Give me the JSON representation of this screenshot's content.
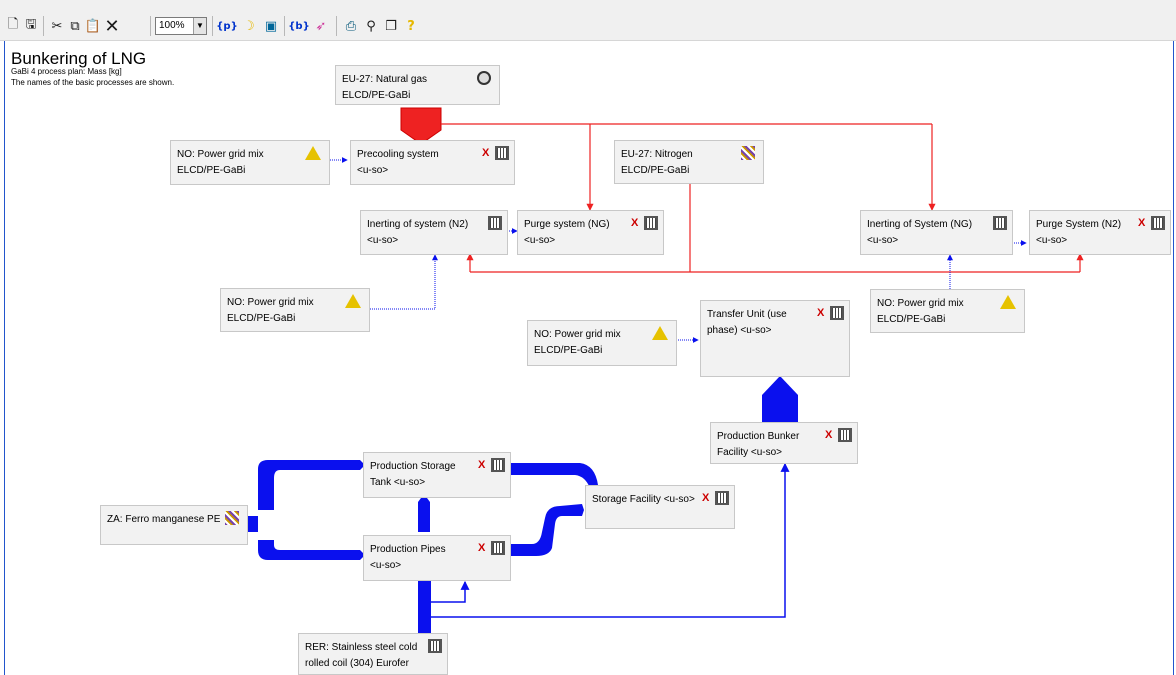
{
  "toolbar": {
    "zoom_value": "100%",
    "buttons": [
      "new-file-icon",
      "save-icon",
      "cut-icon",
      "copy-icon",
      "paste-icon",
      "delete-icon",
      "parameters-icon",
      "moon-icon",
      "layout-icon",
      "balance-icon",
      "flow-icon",
      "print-preview-icon",
      "search-icon",
      "windows-icon",
      "help-icon"
    ]
  },
  "header": {
    "title": "Bunkering of LNG",
    "line1": "GaBi 4 process plan: Mass [kg]",
    "line2": "The names of the basic processes are shown."
  },
  "processes": {
    "natural_gas": {
      "l1": "EU-27: Natural gas",
      "l2": "ELCD/PE-GaBi"
    },
    "power1": {
      "l1": "NO: Power grid mix",
      "l2": "ELCD/PE-GaBi"
    },
    "precooling": {
      "l1": "Precooling system",
      "l2": "<u-so>"
    },
    "nitrogen": {
      "l1": "EU-27: Nitrogen",
      "l2": "ELCD/PE-GaBi"
    },
    "inerting_n2": {
      "l1": "Inerting of system (N2)",
      "l2": "<u-so>"
    },
    "purge_ng": {
      "l1": "Purge system (NG)",
      "l2": "<u-so>"
    },
    "inerting_ng": {
      "l1": "Inerting of System (NG)",
      "l2": "<u-so>"
    },
    "purge_n2": {
      "l1": "Purge System (N2)",
      "l2": "<u-so>"
    },
    "power2": {
      "l1": "NO: Power grid mix",
      "l2": "ELCD/PE-GaBi"
    },
    "power3": {
      "l1": "NO: Power grid mix",
      "l2": "ELCD/PE-GaBi"
    },
    "transfer": {
      "l1": "Transfer Unit (use",
      "l2": "phase) <u-so>"
    },
    "power4": {
      "l1": "NO: Power grid mix",
      "l2": "ELCD/PE-GaBi"
    },
    "bunker": {
      "l1": "Production Bunker",
      "l2": "Facility <u-so>"
    },
    "storage_tank": {
      "l1": "Production Storage",
      "l2": "Tank <u-so>"
    },
    "storage_facility": {
      "l1": "Storage Facility <u-so>",
      "l2": ""
    },
    "ferro": {
      "l1": "ZA: Ferro manganese PE",
      "l2": ""
    },
    "pipes": {
      "l1": "Production Pipes",
      "l2": "<u-so>"
    },
    "steel": {
      "l1": "RER: Stainless steel cold",
      "l2": "rolled coil (304) Eurofer"
    }
  },
  "icons": {
    "x_mark": "X"
  },
  "colors": {
    "red_flow": "#ee2222",
    "blue_flow": "#0a10ee",
    "canvas_border": "#2255cc"
  }
}
